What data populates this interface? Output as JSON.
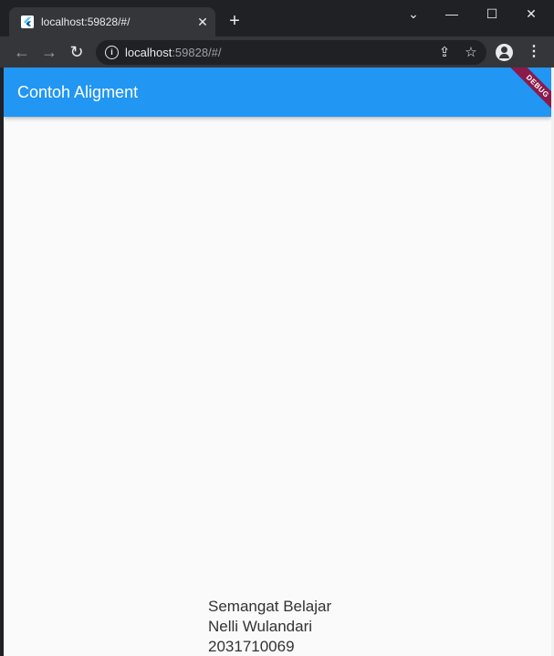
{
  "browser": {
    "tab": {
      "title": "localhost:59828/#/",
      "close_glyph": "✕",
      "favicon": "flutter-logo-icon"
    },
    "new_tab_glyph": "+",
    "window_controls": {
      "tab_search_glyph": "⌄",
      "minimize_glyph": "—",
      "maximize_glyph": "☐",
      "close_glyph": "✕"
    },
    "toolbar": {
      "back_glyph": "←",
      "forward_glyph": "→",
      "reload_glyph": "↻",
      "info_glyph": "i",
      "url_host": "localhost",
      "url_rest": ":59828/#/",
      "share_glyph": "⇪",
      "bookmark_glyph": "☆",
      "menu_glyph": "⋮"
    }
  },
  "app": {
    "appbar_title": "Contoh Aligment",
    "appbar_color": "#2196F3",
    "debug_banner": "DEBUG",
    "lines": [
      "Semangat Belajar",
      "Nelli Wulandari",
      "2031710069"
    ]
  }
}
